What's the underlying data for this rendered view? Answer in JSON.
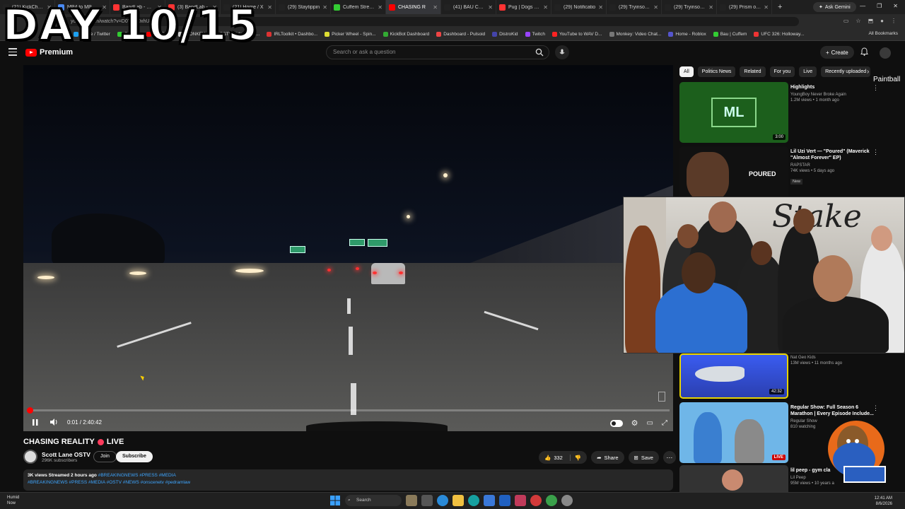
{
  "overlay_text": "DAY 10/15",
  "browser": {
    "tabs": [
      {
        "label": "(21) KickChamp",
        "color": "#222"
      },
      {
        "label": "MP4 to MP3 | C",
        "color": "#4a8af4"
      },
      {
        "label": "BandLab - Mak",
        "color": "#f33"
      },
      {
        "label": "(3) BandLab - ",
        "color": "#f33"
      },
      {
        "label": "(21) Home / X",
        "color": "#222"
      },
      {
        "label": "(29) Staytippin",
        "color": "#222"
      },
      {
        "label": "Cuffem Stream",
        "color": "#3c3"
      },
      {
        "label": "CHASING R",
        "color": "#f00"
      },
      {
        "label": "(41) BAU Comm",
        "color": "#222"
      },
      {
        "label": "Pug | Dogs 101",
        "color": "#f33"
      },
      {
        "label": "(29) Notificatio",
        "color": "#222"
      },
      {
        "label": "(29) Tryinsohar",
        "color": "#222"
      },
      {
        "label": "(29) Tryinsohar",
        "color": "#222"
      },
      {
        "label": "(29) Prism on X",
        "color": "#222"
      }
    ],
    "active_tab_index": 7,
    "new_tab": "+",
    "ask_gemini": "Ask Gemini",
    "address": "youtube.com/watch?v=D0Y5uf0xhU",
    "bookmarks": [
      "Home / Twitter",
      "Cuffem",
      "YouTube",
      "MONKEY",
      "OSTV Video Chat...",
      "IRLToolkit • Dashbo...",
      "Picker Wheel - Spin...",
      "KickBot Dashboard",
      "Dashboard - Pulsoid",
      "DistroKid",
      "Twitch",
      "YouTube to WAV D...",
      "Monkey: Video Chat...",
      "Home - Roblox",
      "Bau | Cuffem",
      "UFC 326: Holloway..."
    ],
    "all_bookmarks": "All Bookmarks"
  },
  "youtube": {
    "brand": "Premium",
    "search_placeholder": "Search or ask a question",
    "create_label": "Create",
    "player": {
      "time": "0:01 / 2:40:42",
      "progress_fraction": 0.0001
    },
    "video": {
      "title": "CHASING REALITY",
      "live_label": "LIVE",
      "channel": "Scott Lane OSTV",
      "subscribers": "296K subscribers",
      "join": "Join",
      "subscribe": "Subscribe",
      "likes": "332",
      "share": "Share",
      "save": "Save",
      "description_stats": "3K views  Streamed 2 hours ago",
      "description_tags_1": "#BREAKINGNEWS #PRESS #MEDIA",
      "description_tags_2": "#BREAKINGNEWS #PRESS #MEDIA #OSTV #NEWS #onscenetv #pedramlaw"
    },
    "chips": [
      "All",
      "Politics News",
      "Related",
      "For you",
      "Live",
      "Recently uploaded"
    ],
    "side_overlay_text": "Paintball",
    "recommendations": [
      {
        "title": "Highlights",
        "channel": "YoungBoy Never Broke Again",
        "views": "1.2M views • 1 month ago",
        "duration": "3:00",
        "thumb": "#1c5f1c"
      },
      {
        "title": "Lil Uzi Vert — \"Poured\" (Maverick \"Almost Forever\" EP)",
        "channel": "RAPSTAR",
        "views": "74K views • 5 days ago",
        "badge": "New",
        "thumb_text": "POURED",
        "thumb": "#111"
      },
      {
        "title": "",
        "channel": "Nat Geo Kids",
        "views": "13M views • 11 months ago",
        "duration": "42:32",
        "thumb": "#2b4fd6"
      },
      {
        "title": "Regular Show: Full Season 6 Marathon | Every Episode Include...",
        "channel": "Regular Show",
        "views": "810 watching",
        "live": "LIVE",
        "thumb": "#6fb6e8"
      },
      {
        "title": "lil peep - gym cla",
        "channel": "Lil Peep",
        "views": "95M views • 10 years a",
        "thumb": "#333"
      }
    ]
  },
  "webcam": {
    "brand_text": "Stake"
  },
  "taskbar": {
    "weather_title": "Humid",
    "weather_sub": "Now",
    "search": "Search",
    "time": "12:41 AM",
    "date": "8/6/2026"
  }
}
